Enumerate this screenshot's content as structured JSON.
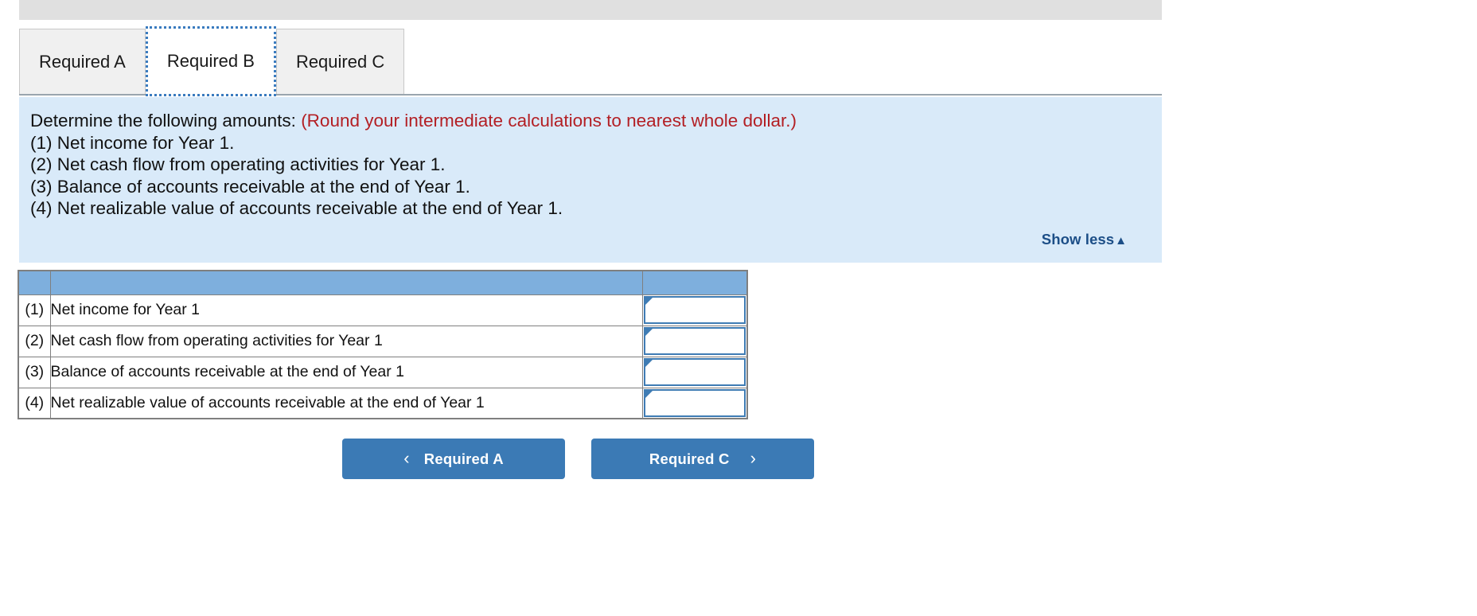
{
  "tabs": [
    {
      "label": "Required A",
      "active": false
    },
    {
      "label": "Required B",
      "active": true
    },
    {
      "label": "Required C",
      "active": false
    }
  ],
  "instructions": {
    "lead_black": "Determine the following amounts:",
    "lead_red": "(Round your intermediate calculations to nearest whole dollar.)",
    "items": [
      "(1) Net income for Year 1.",
      "(2) Net cash flow from operating activities for Year 1.",
      "(3) Balance of accounts receivable at the end of Year 1.",
      "(4) Net realizable value of accounts receivable at the end of Year 1."
    ],
    "show_less_label": "Show less",
    "show_less_caret": "▲"
  },
  "answer_table": {
    "header": {
      "num": "",
      "description": "",
      "value": ""
    },
    "rows": [
      {
        "num": "(1)",
        "description": "Net income for Year 1",
        "value": ""
      },
      {
        "num": "(2)",
        "description": "Net cash flow from operating activities for Year 1",
        "value": ""
      },
      {
        "num": "(3)",
        "description": "Balance of accounts receivable at the end of Year 1",
        "value": ""
      },
      {
        "num": "(4)",
        "description": "Net realizable value of accounts receivable at the end of Year 1",
        "value": ""
      }
    ]
  },
  "nav": {
    "prev_label": "Required A",
    "prev_chevron": "‹",
    "next_label": "Required C",
    "next_chevron": "›"
  },
  "colors": {
    "panel_blue": "#d9eaf9",
    "table_header_blue": "#7eafdd",
    "button_blue": "#3b7ab5",
    "link_navy": "#1c4e87",
    "warning_red": "#b31f24",
    "input_border": "#3f7cb4",
    "tab_inactive": "#f0f0f0",
    "top_bar_gray": "#e0e0e0"
  }
}
